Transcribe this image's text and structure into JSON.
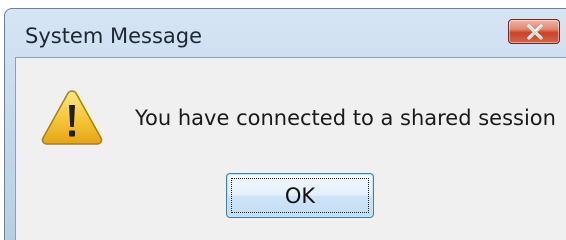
{
  "window": {
    "title": "System Message",
    "close_icon": "close-x-icon"
  },
  "dialog": {
    "icon": "warning-icon",
    "message": "You have connected to a shared session",
    "ok_label": "OK"
  },
  "colors": {
    "title_gradient_top": "#d6e5f5",
    "client_background": "#f0f0f0",
    "close_button_red": "#c9452a",
    "warning_yellow": "#f7c93a",
    "button_border": "#3c7fb1"
  }
}
